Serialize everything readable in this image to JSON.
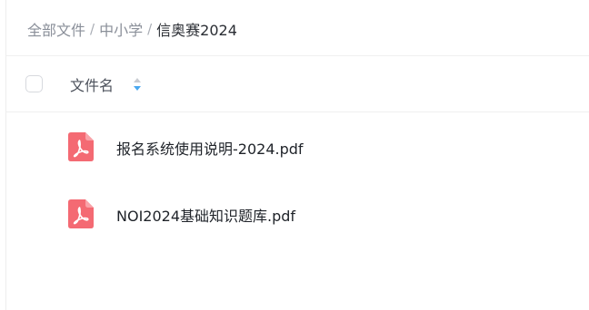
{
  "breadcrumb": {
    "items": [
      {
        "label": "全部文件",
        "current": false
      },
      {
        "label": "中小学",
        "current": false
      },
      {
        "label": "信奥赛2024",
        "current": true
      }
    ],
    "separator": "/"
  },
  "table": {
    "name_header": "文件名",
    "sort_icon": "sort-icon",
    "files": [
      {
        "name": "报名系统使用说明-2024.pdf",
        "icon": "pdf-icon"
      },
      {
        "name": "NOI2024基础知识题库.pdf",
        "icon": "pdf-icon"
      }
    ]
  },
  "colors": {
    "pdf_icon": "#f46a73",
    "sort_active": "#4aa8f0",
    "sort_inactive": "#c8cbd1"
  }
}
